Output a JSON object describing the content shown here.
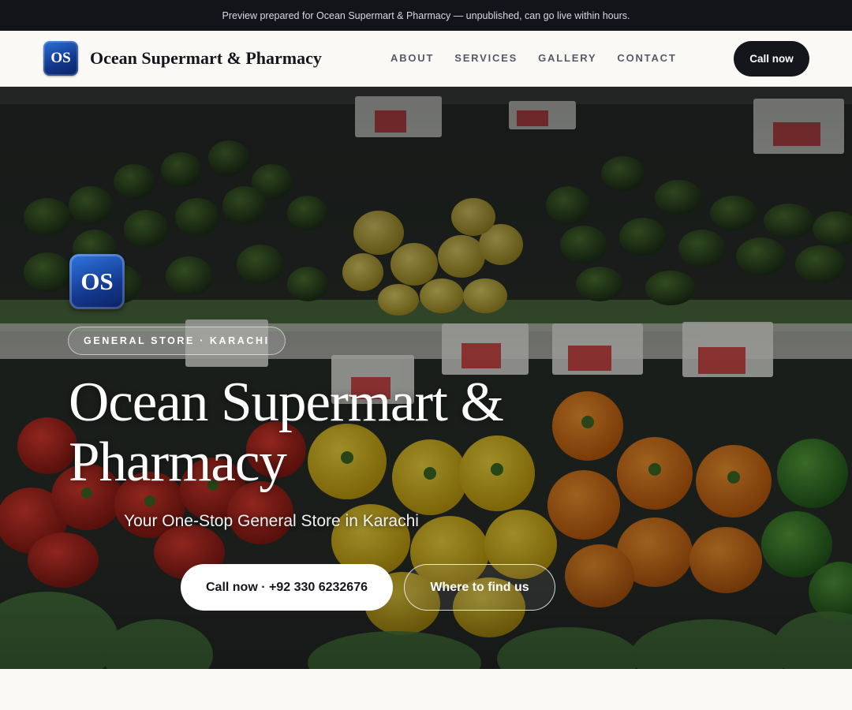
{
  "banner": {
    "text": "Preview prepared for Ocean Supermart & Pharmacy — unpublished, can go live within hours."
  },
  "brand": {
    "logo_initials": "OS",
    "name": "Ocean Supermart & Pharmacy"
  },
  "nav": {
    "links": [
      {
        "label": "ABOUT"
      },
      {
        "label": "SERVICES"
      },
      {
        "label": "GALLERY"
      },
      {
        "label": "CONTACT"
      }
    ],
    "cta_label": "Call now"
  },
  "hero": {
    "logo_initials": "OS",
    "eyebrow": "GENERAL STORE · KARACHI",
    "title": "Ocean Supermart & Pharmacy",
    "tagline": "Your One-Stop General Store in Karachi",
    "primary_cta": "Call now · +92 330 6232676",
    "secondary_cta": "Where to find us"
  },
  "colors": {
    "dark": "#14161c",
    "accent_blue": "#14398f",
    "page_bg": "#faf9f6"
  }
}
